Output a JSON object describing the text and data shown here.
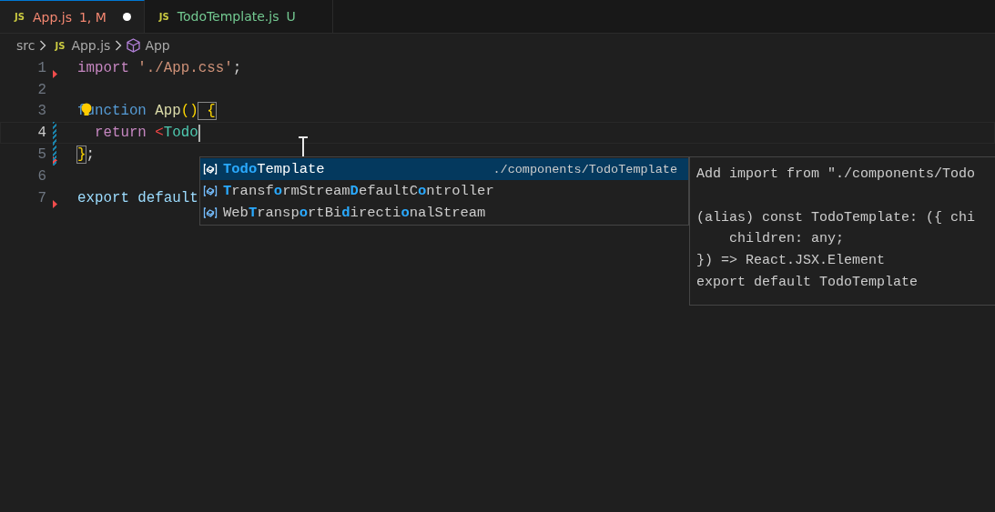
{
  "tabs": [
    {
      "icon_text": "JS",
      "label": "App.js",
      "badge": "1, M",
      "color": "#f48771",
      "selected": true,
      "dirty": true
    },
    {
      "icon_text": "JS",
      "label": "TodoTemplate.js",
      "badge": "U",
      "color": "#73c991",
      "selected": false,
      "dirty": false
    }
  ],
  "breadcrumb": {
    "folder": "src",
    "file_icon_text": "JS",
    "file": "App.js",
    "symbol": "App"
  },
  "editor": {
    "lines": [
      {
        "number": "1",
        "current": false,
        "error_marker": true,
        "modified": false,
        "lightbulb": false,
        "tokens": [
          {
            "kind": "keyword",
            "text": "import"
          },
          {
            "kind": "string",
            "text": " './App.css'"
          },
          {
            "kind": "plain",
            "text": ";"
          }
        ]
      },
      {
        "number": "2",
        "current": false,
        "error_marker": false,
        "modified": false,
        "lightbulb": false
      },
      {
        "number": "3",
        "current": false,
        "error_marker": false,
        "modified": false,
        "lightbulb": true,
        "tokens": [
          {
            "kind": "storage",
            "text": "function"
          },
          {
            "kind": "function",
            "text": " App"
          },
          {
            "kind": "bracket",
            "text": "()"
          },
          {
            "kind": "bracket-match",
            "text": " {"
          }
        ]
      },
      {
        "number": "4",
        "current": true,
        "error_marker": false,
        "modified": true,
        "lightbulb": false,
        "tokens": [
          {
            "kind": "keyword",
            "text": "  return"
          },
          {
            "kind": "tag-punct",
            "text": " <"
          },
          {
            "kind": "component",
            "text": "Todo"
          }
        ]
      },
      {
        "number": "5",
        "current": false,
        "error_marker": true,
        "modified": true,
        "lightbulb": false,
        "tokens": [
          {
            "kind": "bracket-match",
            "text": "}"
          },
          {
            "kind": "plain",
            "text": ";"
          }
        ]
      },
      {
        "number": "6",
        "current": false,
        "error_marker": false,
        "modified": false,
        "lightbulb": false
      },
      {
        "number": "7",
        "current": false,
        "error_marker": true,
        "modified": false,
        "lightbulb": false,
        "tokens": [
          {
            "kind": "variable",
            "text": "export default"
          }
        ]
      }
    ]
  },
  "suggestions": [
    {
      "selected": true,
      "detail": "./components/TodoTemplate",
      "parts": [
        {
          "text": "Todo",
          "match": true
        },
        {
          "text": "Template",
          "match": false
        }
      ]
    },
    {
      "selected": false,
      "parts": [
        {
          "text": "T",
          "match": true
        },
        {
          "text": "ransf",
          "match": false
        },
        {
          "text": "o",
          "match": true
        },
        {
          "text": "rmStream",
          "match": false
        },
        {
          "text": "D",
          "match": true
        },
        {
          "text": "efaultC",
          "match": false
        },
        {
          "text": "o",
          "match": true
        },
        {
          "text": "ntroller",
          "match": false
        }
      ]
    },
    {
      "selected": false,
      "parts": [
        {
          "text": "Web",
          "match": false
        },
        {
          "text": "T",
          "match": true
        },
        {
          "text": "ransp",
          "match": false
        },
        {
          "text": "o",
          "match": true
        },
        {
          "text": "rtBi",
          "match": false
        },
        {
          "text": "d",
          "match": true
        },
        {
          "text": "irecti",
          "match": false
        },
        {
          "text": "o",
          "match": true
        },
        {
          "text": "nalStream",
          "match": false
        }
      ]
    }
  ],
  "details": {
    "heading": "Add import from \"./components/Todo",
    "code_lines": [
      "(alias) const TodoTemplate: ({ chi",
      "    children: any;",
      "}) => React.JSX.Element",
      "export default TodoTemplate"
    ]
  }
}
